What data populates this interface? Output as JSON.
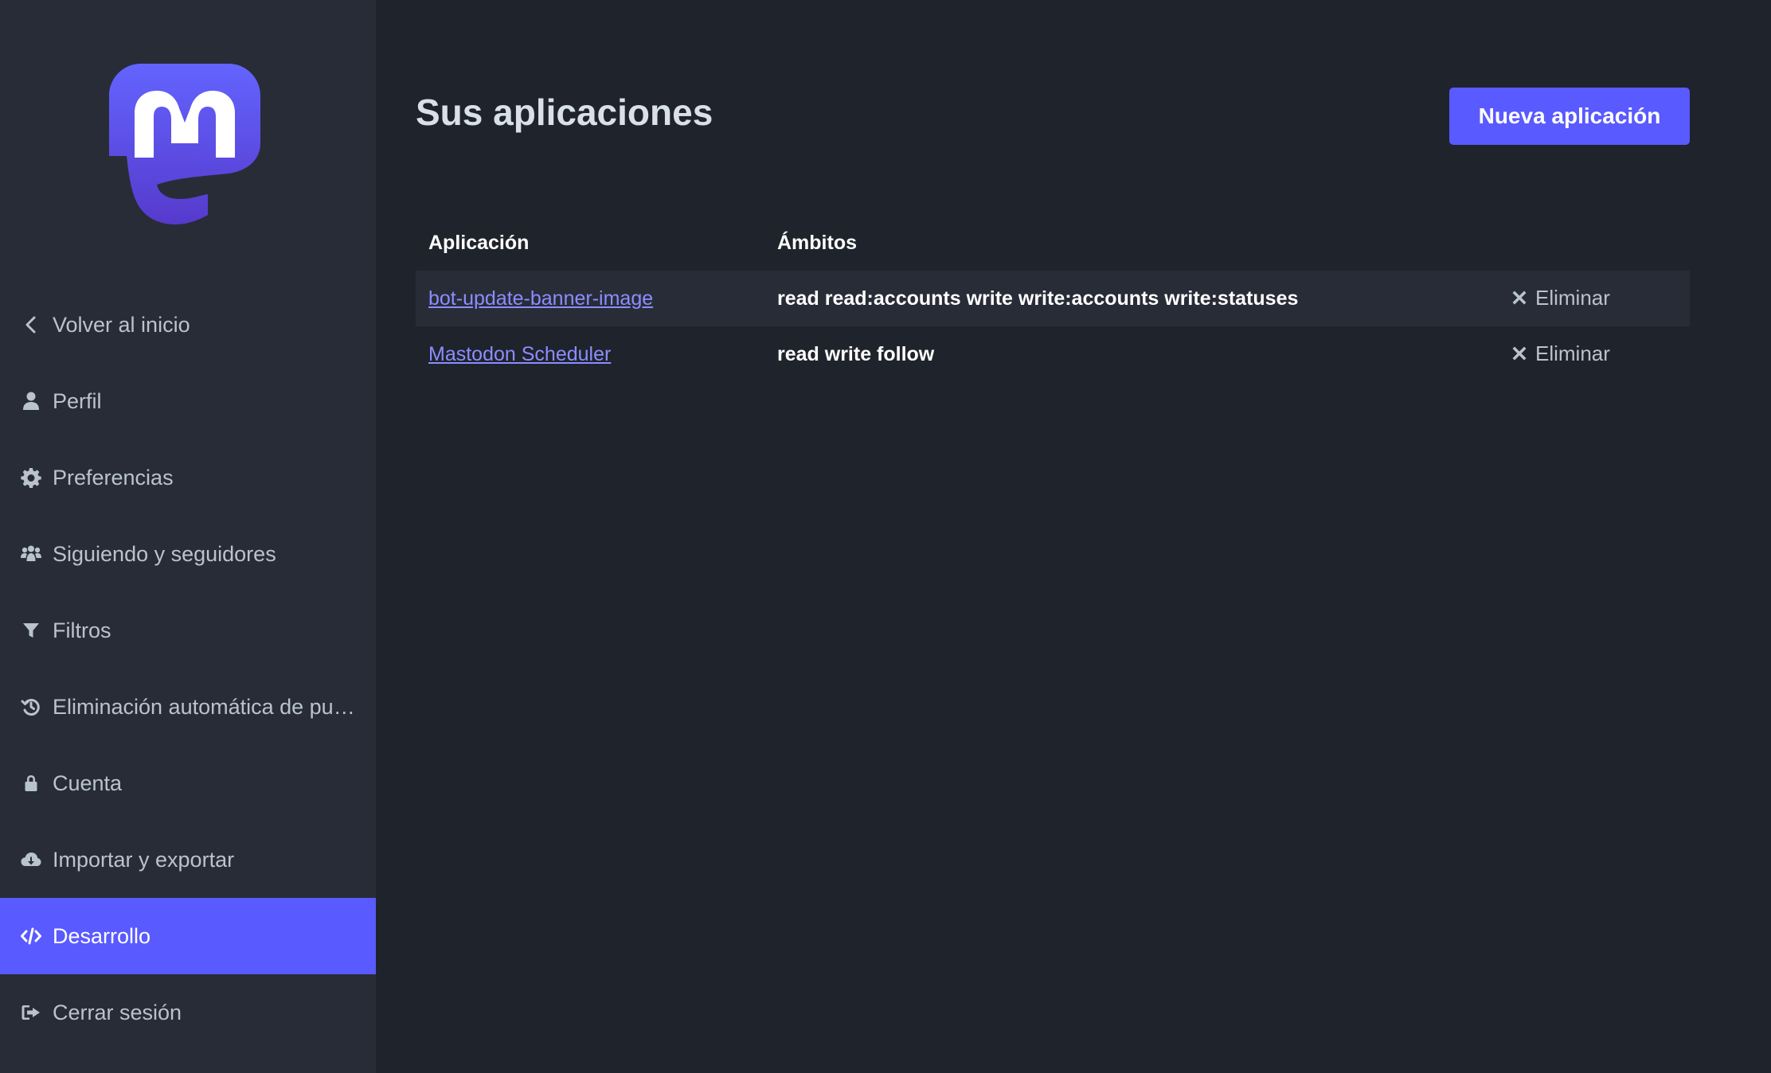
{
  "sidebar": {
    "logo_icon": "mastodon-logo-icon",
    "items": [
      {
        "label": "Volver al inicio",
        "icon": "chevron-left-icon",
        "active": false
      },
      {
        "label": "Perfil",
        "icon": "user-icon",
        "active": false
      },
      {
        "label": "Preferencias",
        "icon": "gear-icon",
        "active": false
      },
      {
        "label": "Siguiendo y seguidores",
        "icon": "users-icon",
        "active": false
      },
      {
        "label": "Filtros",
        "icon": "filter-icon",
        "active": false
      },
      {
        "label": "Eliminación automática de publicaciones",
        "icon": "history-icon",
        "active": false
      },
      {
        "label": "Cuenta",
        "icon": "lock-icon",
        "active": false
      },
      {
        "label": "Importar y exportar",
        "icon": "cloud-download-icon",
        "active": false
      },
      {
        "label": "Desarrollo",
        "icon": "code-icon",
        "active": true
      },
      {
        "label": "Cerrar sesión",
        "icon": "sign-out-icon",
        "active": false
      }
    ]
  },
  "main": {
    "title": "Sus aplicaciones",
    "new_app_button": "Nueva aplicación",
    "table": {
      "headers": {
        "app": "Aplicación",
        "scopes": "Ámbitos"
      },
      "rows": [
        {
          "name": "bot-update-banner-image",
          "scopes": "read read:accounts write write:accounts write:statuses",
          "delete_label": "Eliminar"
        },
        {
          "name": "Mastodon Scheduler",
          "scopes": "read write follow",
          "delete_label": "Eliminar"
        }
      ]
    }
  },
  "colors": {
    "accent": "#595aff",
    "link": "#8c8dff",
    "sidebar_bg": "#282c37",
    "main_bg": "#1f232b"
  }
}
